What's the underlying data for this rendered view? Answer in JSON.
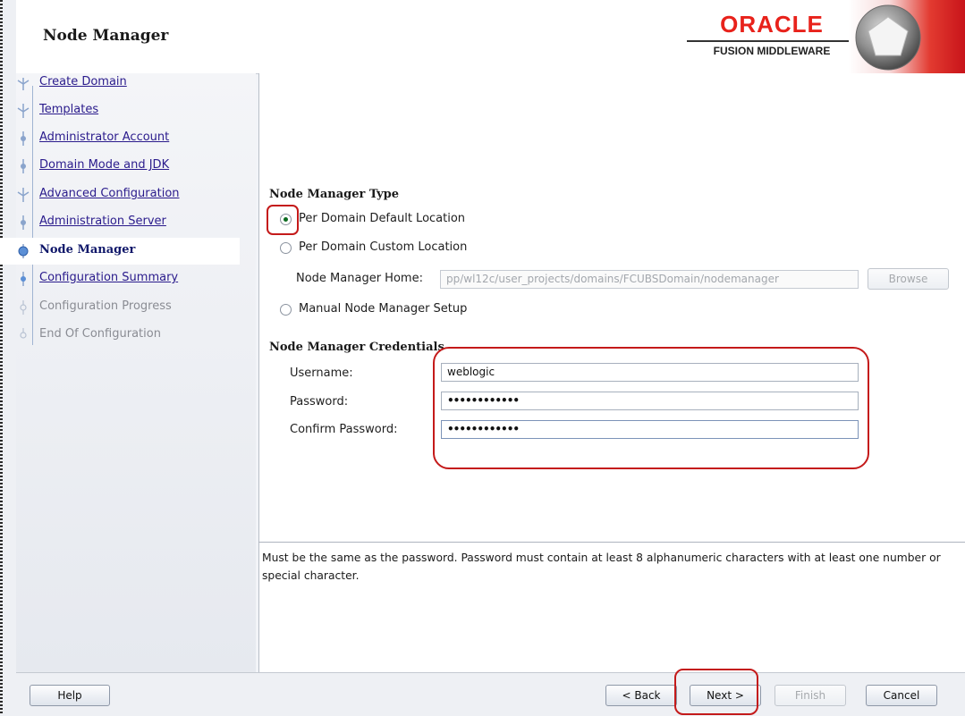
{
  "header": {
    "title": "Node Manager",
    "brand_name": "ORACLE",
    "brand_subtitle": "FUSION MIDDLEWARE"
  },
  "sidebar": {
    "steps": [
      {
        "label": "Create Domain",
        "state": "visited",
        "icon": "branch-icon"
      },
      {
        "label": "Templates",
        "state": "visited",
        "icon": "branch-icon"
      },
      {
        "label": "Administrator Account",
        "state": "visited",
        "icon": "step-dot-icon"
      },
      {
        "label": "Domain Mode and JDK",
        "state": "visited",
        "icon": "step-dot-icon"
      },
      {
        "label": "Advanced Configuration",
        "state": "visited",
        "icon": "branch-icon"
      },
      {
        "label": "Administration Server",
        "state": "visited",
        "icon": "step-dot-icon"
      },
      {
        "label": "Node Manager",
        "state": "current",
        "icon": "current-step-icon"
      },
      {
        "label": "Configuration Summary",
        "state": "visited",
        "icon": "step-dot-icon"
      },
      {
        "label": "Configuration Progress",
        "state": "future",
        "icon": "step-circle-icon"
      },
      {
        "label": "End Of Configuration",
        "state": "future",
        "icon": "step-circle-icon"
      }
    ]
  },
  "node_manager_type": {
    "title": "Node Manager Type",
    "options": [
      {
        "label": "Per Domain Default Location",
        "checked": true
      },
      {
        "label": "Per Domain Custom Location",
        "checked": false
      },
      {
        "label": "Manual Node Manager Setup",
        "checked": false
      }
    ],
    "home_label": "Node Manager Home:",
    "home_value": "pp/wl12c/user_projects/domains/FCUBSDomain/nodemanager",
    "browse_label": "Browse"
  },
  "credentials": {
    "title": "Node Manager Credentials",
    "username_label": "Username:",
    "username_value": "weblogic",
    "password_label": "Password:",
    "password_value": "••••••••••••",
    "confirm_label": "Confirm Password:",
    "confirm_value": "••••••••••••"
  },
  "help_text": "Must be the same as the password. Password must contain at least 8 alphanumeric characters with at least one number or special character.",
  "footer": {
    "help": "Help",
    "back": "< Back",
    "next": "Next >",
    "finish": "Finish",
    "cancel": "Cancel"
  },
  "colors": {
    "highlight": "#c41a1a",
    "oracle_red": "#e8221b",
    "visited_link": "#2a1b8c",
    "current_step": "#10186a"
  }
}
